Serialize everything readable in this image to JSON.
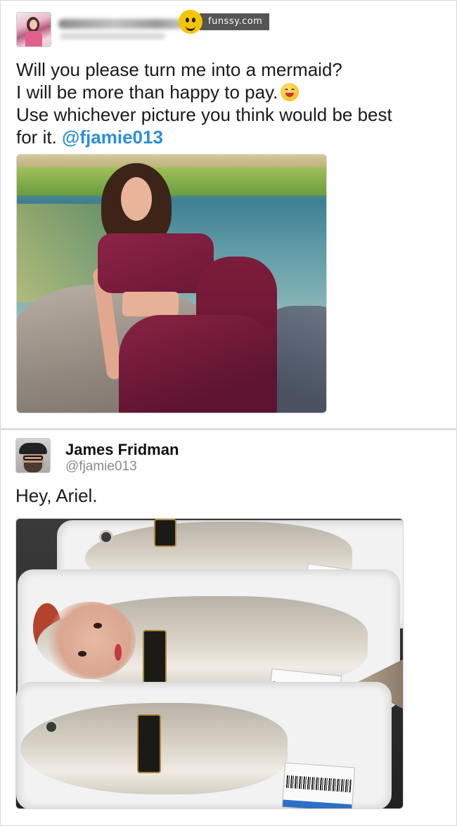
{
  "watermark": {
    "text": "funssy.com",
    "logo_icon": "funssy-mascot-icon"
  },
  "tweet1": {
    "name_redacted": true,
    "lines": [
      "Will you please turn me into a mermaid?",
      "I will be more than happy to pay.",
      "Use whichever picture you think would be best",
      "for it."
    ],
    "emoji": "smiling-face-emoji",
    "mention": "@fjamie013"
  },
  "tweet2": {
    "name": "James Fridman",
    "handle": "@fjamie013",
    "text": "Hey, Ariel."
  },
  "colors": {
    "mention": "#2b8fd6",
    "handle": "#8a8a8a",
    "watermark_bg": "#555555"
  }
}
